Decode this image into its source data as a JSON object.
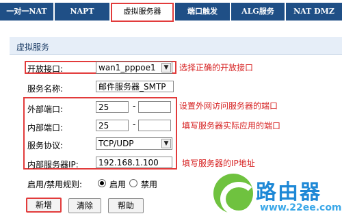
{
  "tabs": [
    {
      "label": "一对一NAT",
      "active": false
    },
    {
      "label": "NAPT",
      "active": false
    },
    {
      "label": "虚拟服务器",
      "active": true
    },
    {
      "label": "端口触发",
      "active": false
    },
    {
      "label": "ALG服务",
      "active": false
    },
    {
      "label": "NAT DMZ",
      "active": false
    }
  ],
  "section": {
    "title": "虚拟服务"
  },
  "form": {
    "interface": {
      "label": "开放接口:",
      "value": "wan1_pppoe1",
      "annotation": "选择正确的开放接口"
    },
    "service_name": {
      "label": "服务名称:",
      "value": "邮件服务器_SMTP"
    },
    "external_port": {
      "label": "外部端口:",
      "from": "25",
      "sep": "-",
      "to": "",
      "annotation": "设置外网访问服务器的端口"
    },
    "internal_port": {
      "label": "内部端口:",
      "from": "25",
      "sep": "-",
      "to": "",
      "annotation": "填写服务器实际应用的端口"
    },
    "protocol": {
      "label": "服务协议:",
      "value": "TCP/UDP"
    },
    "internal_ip": {
      "label": "内部服务器IP:",
      "value": "192.168.1.100",
      "annotation": "填写服务器的IP地址"
    },
    "rule": {
      "label": "启用/禁用规则:",
      "options": [
        "启用",
        "禁用"
      ],
      "selected": "启用"
    }
  },
  "buttons": {
    "add": "新增",
    "clear": "清除",
    "help": "帮助"
  },
  "watermark": {
    "brand": "路由器",
    "url": "www.22ee.com"
  },
  "colors": {
    "tab_bg": "#1f4f86",
    "highlight": "#e23b3b",
    "annotation": "#d61f1f",
    "section_bg": "#e6eef8"
  }
}
